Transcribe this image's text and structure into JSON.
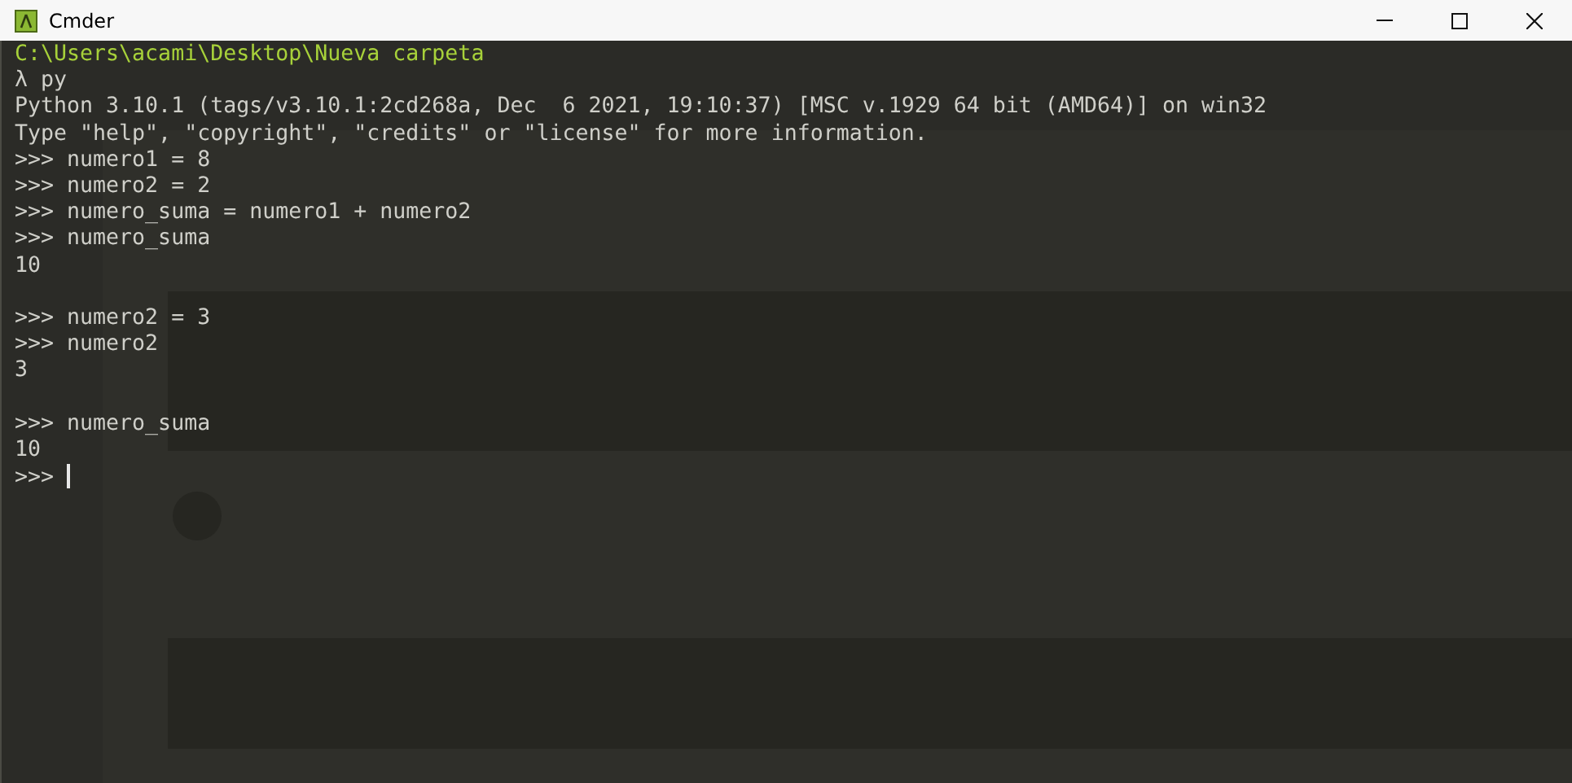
{
  "window": {
    "title": "Cmder"
  },
  "console": {
    "lines": [
      {
        "kind": "path",
        "text": "C:\\Users\\acami\\Desktop\\Nueva carpeta"
      },
      {
        "kind": "output",
        "text": "λ py"
      },
      {
        "kind": "output",
        "text": "Python 3.10.1 (tags/v3.10.1:2cd268a, Dec  6 2021, 19:10:37) [MSC v.1929 64 bit (AMD64)] on win32"
      },
      {
        "kind": "output",
        "text": "Type \"help\", \"copyright\", \"credits\" or \"license\" for more information."
      },
      {
        "kind": "output",
        "text": ">>> numero1 = 8"
      },
      {
        "kind": "output",
        "text": ">>> numero2 = 2"
      },
      {
        "kind": "output",
        "text": ">>> numero_suma = numero1 + numero2"
      },
      {
        "kind": "output",
        "text": ">>> numero_suma"
      },
      {
        "kind": "output",
        "text": "10"
      },
      {
        "kind": "blank"
      },
      {
        "kind": "output",
        "text": ">>> numero2 = 3"
      },
      {
        "kind": "output",
        "text": ">>> numero2"
      },
      {
        "kind": "output",
        "text": "3"
      },
      {
        "kind": "blank"
      },
      {
        "kind": "output",
        "text": ">>> numero_suma"
      },
      {
        "kind": "output",
        "text": "10"
      },
      {
        "kind": "input",
        "text": ">>> "
      }
    ]
  }
}
